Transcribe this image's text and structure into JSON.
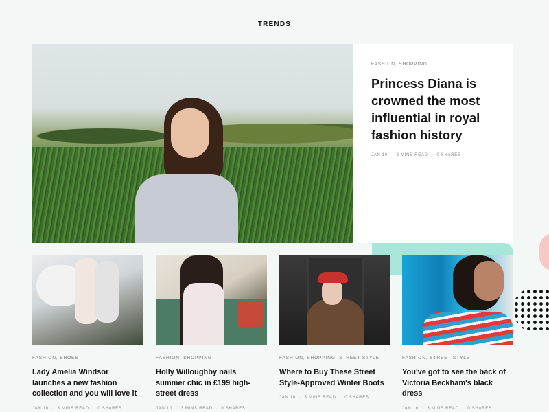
{
  "page": {
    "section_title": "TRENDS"
  },
  "hero": {
    "tags": [
      "FASHION",
      "SHOPPING"
    ],
    "title": "Princess Diana is crowned the most influential in royal fashion history",
    "meta": {
      "date": "JAN 10",
      "read": "3 MINS READ",
      "shares": "0 SHARES"
    }
  },
  "cards": [
    {
      "tags": [
        "FASHION",
        "SHOES"
      ],
      "title": "Lady Amelia Windsor launches a new fashion collection and you will love it",
      "meta": {
        "date": "JAN 10",
        "read": "3 MINS READ",
        "shares": "0 SHARES"
      }
    },
    {
      "tags": [
        "FASHION",
        "SHOPPING"
      ],
      "title": "Holly Willoughby nails summer chic in £199 high-street dress",
      "meta": {
        "date": "JAN 10",
        "read": "3 MINS READ",
        "shares": "0 SHARES"
      }
    },
    {
      "tags": [
        "FASHION",
        "SHOPPING",
        "STREET STYLE"
      ],
      "title": "Where to Buy These Street Style-Approved Winter Boots",
      "meta": {
        "date": "JAN 10",
        "read": "3 MINS READ",
        "shares": "0 SHARES"
      }
    },
    {
      "tags": [
        "FASHION",
        "STREET STYLE"
      ],
      "title": "You've got to see the back of Victoria Beckham's black dress",
      "meta": {
        "date": "JAN 10",
        "read": "3 MINS READ",
        "shares": "0 SHARES"
      }
    }
  ],
  "colors": {
    "background": "#f3f7f5",
    "accent_teal": "#a9e6da",
    "accent_pink": "#f7c9c6"
  }
}
